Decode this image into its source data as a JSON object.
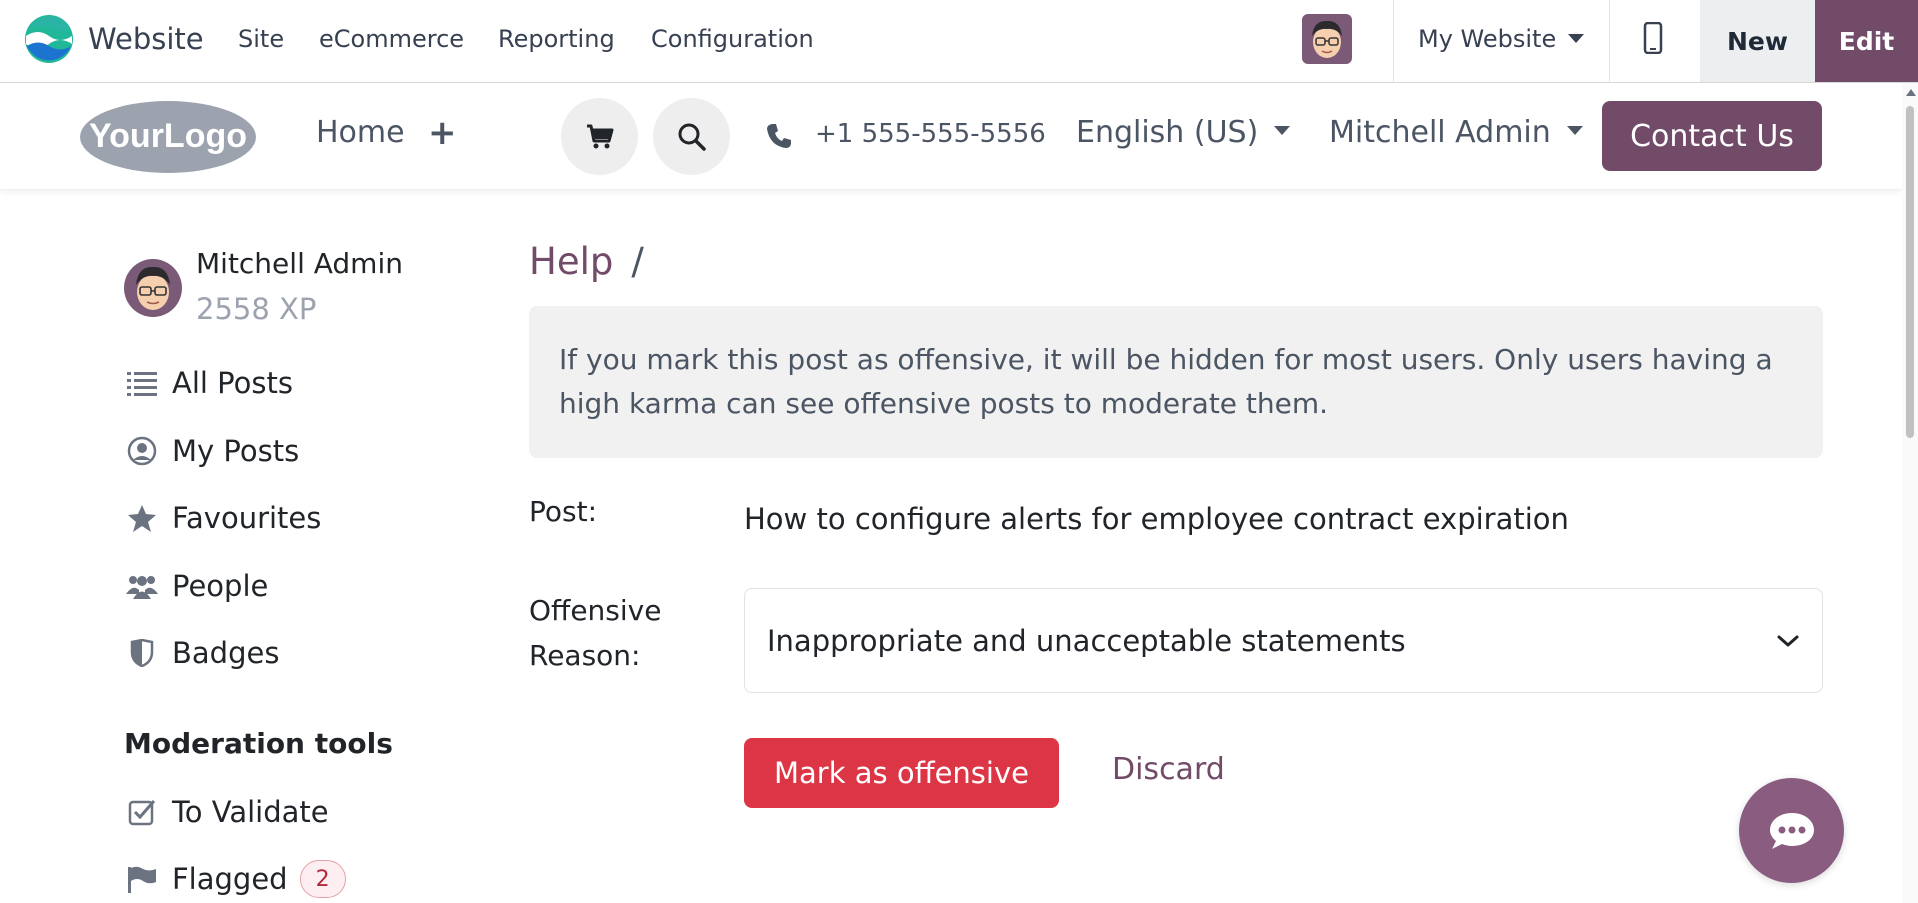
{
  "topbar": {
    "app_name": "Website",
    "menus": [
      "Site",
      "eCommerce",
      "Reporting",
      "Configuration"
    ],
    "website_selector": "My Website",
    "new_label": "New",
    "edit_label": "Edit"
  },
  "header": {
    "logo_text": "YourLogo",
    "nav_home": "Home",
    "nav_add": "+",
    "phone": "+1 555-555-5556",
    "language": "English (US)",
    "user": "Mitchell Admin",
    "contact_label": "Contact Us"
  },
  "sidebar": {
    "user_name": "Mitchell Admin",
    "user_xp": "2558 XP",
    "items": [
      {
        "label": "All Posts",
        "icon": "list-icon"
      },
      {
        "label": "My Posts",
        "icon": "user-circle-icon"
      },
      {
        "label": "Favourites",
        "icon": "star-icon"
      },
      {
        "label": "People",
        "icon": "users-icon"
      },
      {
        "label": "Badges",
        "icon": "shield-icon"
      }
    ],
    "moderation_title": "Moderation tools",
    "moderation_items": [
      {
        "label": "To Validate",
        "icon": "check-square-icon"
      },
      {
        "label": "Flagged",
        "icon": "flag-icon",
        "badge": "2"
      }
    ]
  },
  "main": {
    "breadcrumb": "Help",
    "breadcrumb_sep": "/",
    "alert_text": "If you mark this post as offensive, it will be hidden for most users. Only users having a high karma can see offensive posts to moderate them.",
    "post_label": "Post:",
    "post_title": "How to configure alerts for employee contract expiration",
    "reason_label_line1": "Offensive",
    "reason_label_line2": "Reason:",
    "reason_value": "Inappropriate and unacceptable statements",
    "mark_label": "Mark as offensive",
    "discard_label": "Discard"
  },
  "colors": {
    "brand": "#714b67",
    "danger": "#dc3545",
    "chat": "#8a5c80"
  }
}
